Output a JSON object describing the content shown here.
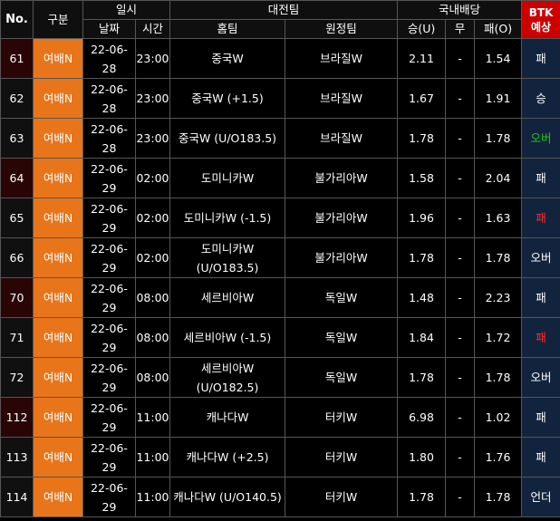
{
  "headers": {
    "no": "No.",
    "category": "구분",
    "datetime": "일시",
    "date": "날짜",
    "time": "시간",
    "matchup": "대전팀",
    "home": "홈팀",
    "away": "원정팀",
    "odds": "국내배당",
    "win": "승(U)",
    "draw": "무",
    "lose": "패(O)",
    "btk_line1": "BTK",
    "btk_line2": "예상"
  },
  "rows": [
    {
      "no": "61",
      "cat": "여배N",
      "date_a": "22-06-",
      "date_b": "28",
      "time": "23:00",
      "home": "중국W",
      "away": "브라질W",
      "win": "2.11",
      "draw": "-",
      "lose": "1.54",
      "pred": "패",
      "pred_color": "white",
      "num_bg": "red"
    },
    {
      "no": "62",
      "cat": "여배N",
      "date_a": "22-06-",
      "date_b": "28",
      "time": "23:00",
      "home": "중국W (+1.5)",
      "away": "브라질W",
      "win": "1.67",
      "draw": "-",
      "lose": "1.91",
      "pred": "승",
      "pred_color": "white",
      "num_bg": "dark"
    },
    {
      "no": "63",
      "cat": "여배N",
      "date_a": "22-06-",
      "date_b": "28",
      "time": "23:00",
      "home": "중국W (U/O183.5)",
      "away": "브라질W",
      "win": "1.78",
      "draw": "-",
      "lose": "1.78",
      "pred": "오버",
      "pred_color": "green",
      "num_bg": "dark"
    },
    {
      "no": "64",
      "cat": "여배N",
      "date_a": "22-06-",
      "date_b": "29",
      "time": "02:00",
      "home": "도미니카W",
      "away": "불가리아W",
      "win": "1.58",
      "draw": "-",
      "lose": "2.04",
      "pred": "패",
      "pred_color": "white",
      "num_bg": "red"
    },
    {
      "no": "65",
      "cat": "여배N",
      "date_a": "22-06-",
      "date_b": "29",
      "time": "02:00",
      "home": "도미니카W (-1.5)",
      "away": "불가리아W",
      "win": "1.96",
      "draw": "-",
      "lose": "1.63",
      "pred": "패",
      "pred_color": "red",
      "num_bg": "dark"
    },
    {
      "no": "66",
      "cat": "여배N",
      "date_a": "22-06-",
      "date_b": "29",
      "time": "02:00",
      "home": "도미니카W (U/O183.5)",
      "away": "불가리아W",
      "win": "1.78",
      "draw": "-",
      "lose": "1.78",
      "pred": "오버",
      "pred_color": "white",
      "num_bg": "dark"
    },
    {
      "no": "70",
      "cat": "여배N",
      "date_a": "22-06-",
      "date_b": "29",
      "time": "08:00",
      "home": "세르비아W",
      "away": "독일W",
      "win": "1.48",
      "draw": "-",
      "lose": "2.23",
      "pred": "패",
      "pred_color": "white",
      "num_bg": "red"
    },
    {
      "no": "71",
      "cat": "여배N",
      "date_a": "22-06-",
      "date_b": "29",
      "time": "08:00",
      "home": "세르비아W (-1.5)",
      "away": "독일W",
      "win": "1.84",
      "draw": "-",
      "lose": "1.72",
      "pred": "패",
      "pred_color": "red",
      "num_bg": "dark"
    },
    {
      "no": "72",
      "cat": "여배N",
      "date_a": "22-06-",
      "date_b": "29",
      "time": "08:00",
      "home": "세르비아W (U/O182.5)",
      "away": "독일W",
      "win": "1.78",
      "draw": "-",
      "lose": "1.78",
      "pred": "오버",
      "pred_color": "white",
      "num_bg": "dark"
    },
    {
      "no": "112",
      "cat": "여배N",
      "date_a": "22-06-",
      "date_b": "29",
      "time": "11:00",
      "home": "캐나다W",
      "away": "터키W",
      "win": "6.98",
      "draw": "-",
      "lose": "1.02",
      "pred": "패",
      "pred_color": "white",
      "num_bg": "red"
    },
    {
      "no": "113",
      "cat": "여배N",
      "date_a": "22-06-",
      "date_b": "29",
      "time": "11:00",
      "home": "캐나다W (+2.5)",
      "away": "터키W",
      "win": "1.80",
      "draw": "-",
      "lose": "1.76",
      "pred": "패",
      "pred_color": "white",
      "num_bg": "dark"
    },
    {
      "no": "114",
      "cat": "여배N",
      "date_a": "22-06-",
      "date_b": "29",
      "time": "11:00",
      "home": "캐나다W (U/O140.5)",
      "away": "터키W",
      "win": "1.78",
      "draw": "-",
      "lose": "1.78",
      "pred": "언더",
      "pred_color": "white",
      "num_bg": "dark"
    }
  ]
}
